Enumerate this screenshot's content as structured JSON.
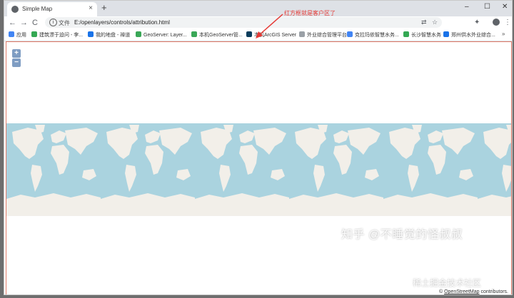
{
  "tab": {
    "title": "Simple Map",
    "new_tab": "+",
    "close": "×"
  },
  "window_controls": {
    "minimize": "–",
    "restore": "☐",
    "close": "✕"
  },
  "nav": {
    "back": "←",
    "forward": "→",
    "reload": "C"
  },
  "address": {
    "scheme": "文件",
    "url": "E:/openlayers/controls/attribution.html"
  },
  "bookmarks": [
    {
      "label": "应用",
      "color": "#4285f4"
    },
    {
      "label": "建筑漂于迫问 - 李...",
      "color": "#34a853"
    },
    {
      "label": "我的地盘 - 禅道",
      "color": "#1a73e8"
    },
    {
      "label": "GeoServer: Layer...",
      "color": "#3aa757"
    },
    {
      "label": "本机GeoServer管...",
      "color": "#3aa757"
    },
    {
      "label": "本机ArcGIS Server",
      "color": "#0b3d5c"
    },
    {
      "label": "外业综合管理平台",
      "color": "#9aa0a6"
    },
    {
      "label": "克拉玛依智慧水务...",
      "color": "#4285f4"
    },
    {
      "label": "长沙智慧水务",
      "color": "#34a853"
    },
    {
      "label": "郑州供水外业综合...",
      "color": "#1a73e8"
    }
  ],
  "bookmarks_more": "»",
  "annotation": "红方框就是客户区了",
  "zoom": {
    "in": "+",
    "out": "−"
  },
  "attribution": {
    "prefix": "©",
    "link": "OpenStreetMap",
    "suffix": "contributors."
  },
  "watermark": "知乎 @不睡觉的怪叔叔",
  "watermark2": "稀土掘金技术社区",
  "colors": {
    "ocean": "#aad3df",
    "land": "#f2efe9",
    "annotation": "#e53935"
  }
}
